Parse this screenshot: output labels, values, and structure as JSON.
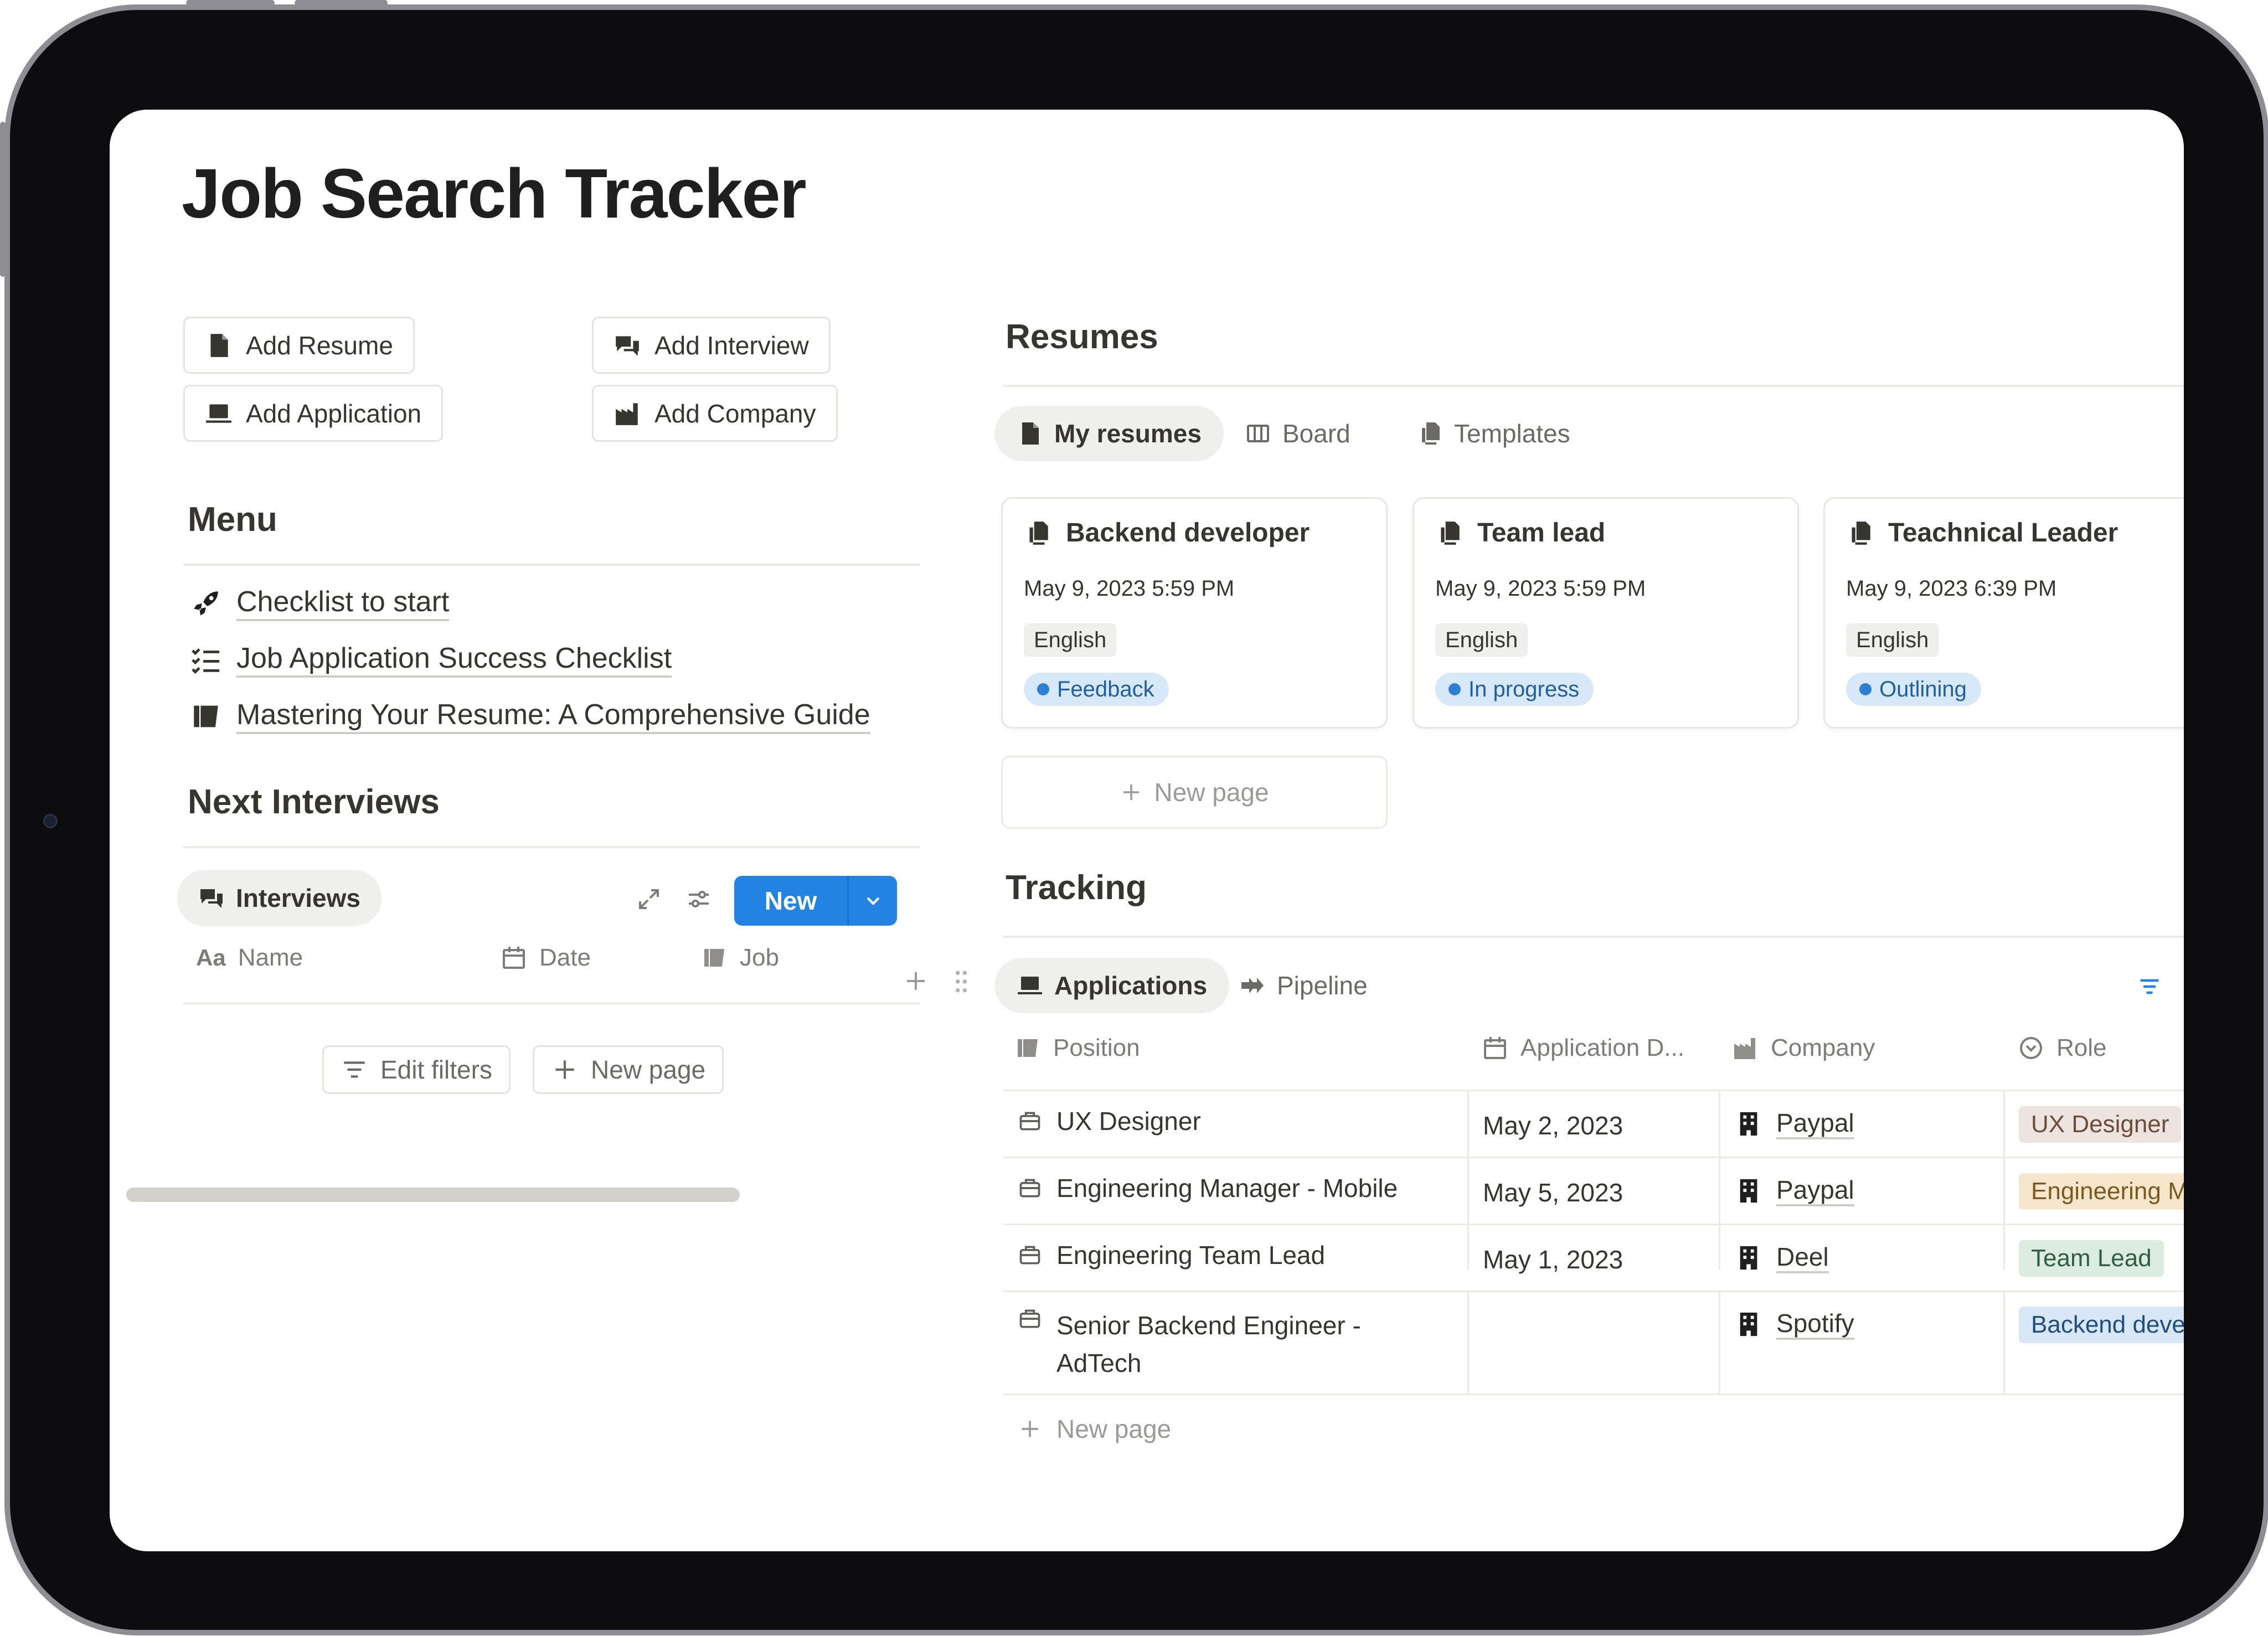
{
  "page": {
    "title": "Job Search Tracker"
  },
  "actions": [
    {
      "label": "Add Resume",
      "icon": "page-icon"
    },
    {
      "label": "Add Interview",
      "icon": "chat-bubbles-icon"
    },
    {
      "label": "Add Application",
      "icon": "laptop-icon"
    },
    {
      "label": "Add Company",
      "icon": "factory-icon"
    }
  ],
  "menu": {
    "heading": "Menu",
    "items": [
      {
        "label": "Checklist to start",
        "icon": "rocket-icon"
      },
      {
        "label": "Job Application Success Checklist",
        "icon": "checklist-icon"
      },
      {
        "label": "Mastering Your Resume: A Comprehensive Guide",
        "icon": "scroll-icon"
      }
    ]
  },
  "interviews": {
    "heading": "Next Interviews",
    "view_label": "Interviews",
    "new_label": "New",
    "columns": [
      "Name",
      "Date",
      "Job"
    ],
    "edit_filters": "Edit filters",
    "new_page": "New page"
  },
  "resumes": {
    "heading": "Resumes",
    "tabs": [
      "My resumes",
      "Board",
      "Templates"
    ],
    "cards": [
      {
        "title": "Backend developer",
        "date": "May 9, 2023 5:59 PM",
        "language": "English",
        "status": "Feedback"
      },
      {
        "title": "Team lead",
        "date": "May 9, 2023 5:59 PM",
        "language": "English",
        "status": "In progress"
      },
      {
        "title": "Teachnical Leader",
        "date": "May 9, 2023 6:39 PM",
        "language": "English",
        "status": "Outlining"
      }
    ],
    "new_page": "New page"
  },
  "tracking": {
    "heading": "Tracking",
    "tabs": [
      "Applications",
      "Pipeline"
    ],
    "columns": [
      "Position",
      "Application D...",
      "Company",
      "Role"
    ],
    "rows": [
      {
        "position": "UX Designer",
        "position_line2": "",
        "date": "May 2, 2023",
        "company": "Paypal",
        "role": "UX Designer",
        "role_color": "#ede4df",
        "role_text": "#6b4d3d"
      },
      {
        "position": "Engineering Manager - Mobile",
        "position_line2": "",
        "date": "May 5, 2023",
        "company": "Paypal",
        "role": "Engineering M",
        "role_color": "#f6e6cc",
        "role_text": "#7a5a20"
      },
      {
        "position": "Engineering Team Lead",
        "position_line2": "",
        "date": "May 1, 2023",
        "company": "Deel",
        "role": "Team Lead",
        "role_color": "#dcece1",
        "role_text": "#2f5f3f"
      },
      {
        "position": "Senior Backend Engineer -",
        "position_line2": "AdTech",
        "date": "",
        "company": "Spotify",
        "role": "Backend deve",
        "role_color": "#d8e6f6",
        "role_text": "#1f4f80"
      }
    ],
    "new_page": "New page"
  }
}
